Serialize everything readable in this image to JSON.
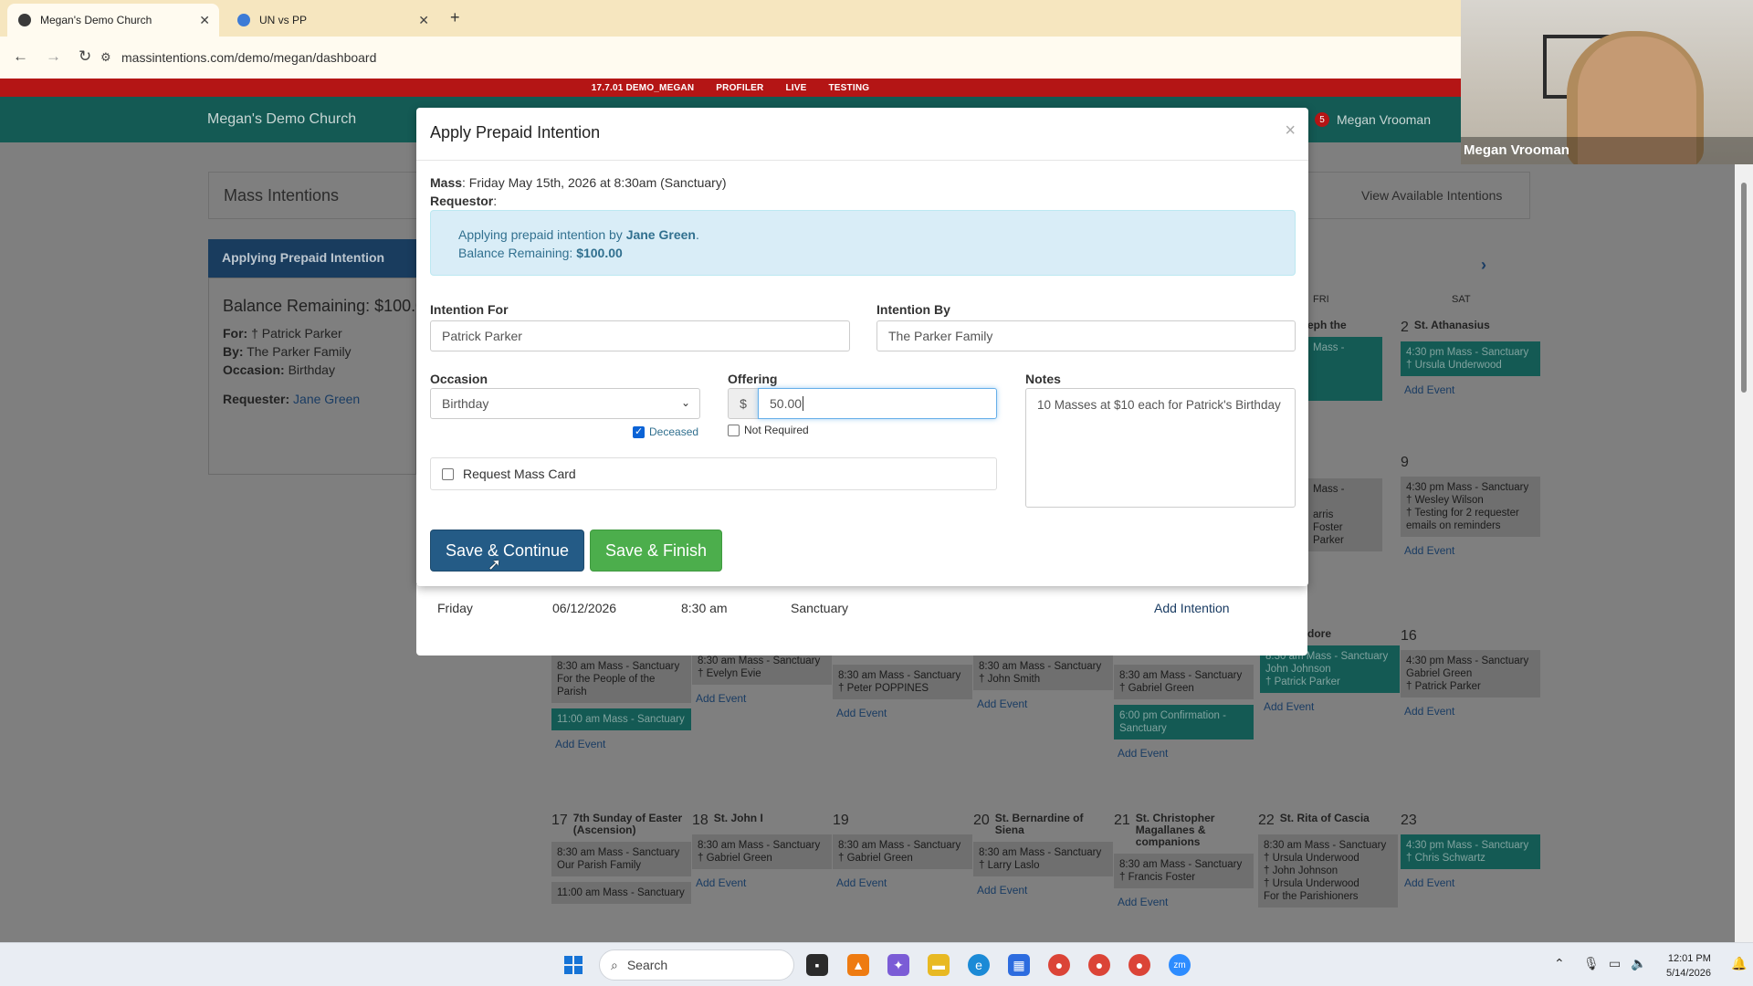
{
  "browser": {
    "tabs": [
      {
        "label": "Megan's Demo Church",
        "active": true
      },
      {
        "label": "UN vs PP",
        "active": false
      }
    ],
    "url": "massintentions.com/demo/megan/dashboard"
  },
  "envbar": [
    "17.7.01 DEMO_MEGAN",
    "PROFILER",
    "LIVE",
    "TESTING"
  ],
  "navbar": {
    "brand": "Megan's Demo Church",
    "badge": "5",
    "user": "Megan Vrooman"
  },
  "background": {
    "panel_title": "Mass Intentions",
    "view_available": "View Available Intentions",
    "left_card": {
      "header": "Applying Prepaid Intention",
      "balance": "Balance Remaining: $100.00",
      "for_label": "For:",
      "for_value": "† Patrick Parker",
      "by_label": "By:",
      "by_value": "The Parker Family",
      "occasion_label": "Occasion:",
      "occasion_value": "Birthday",
      "requester_label": "Requester:",
      "requester_value": "Jane Green"
    },
    "under_row": {
      "day": "Friday",
      "date": "06/12/2026",
      "time": "8:30 am",
      "location": "Sanctuary",
      "action": "Add Intention"
    },
    "calendar": {
      "dow": [
        "FRI",
        "SAT"
      ],
      "add_event": "Add Event"
    }
  },
  "modal": {
    "title": "Apply Prepaid Intention",
    "mass_label": "Mass",
    "mass_value": ": Friday May 15th, 2026 at 8:30am (Sanctuary)",
    "requestor_label": "Requestor",
    "info_prefix": "Applying prepaid intention by ",
    "info_name": "Jane Green",
    "info_balance_label": "Balance Remaining: ",
    "info_balance_value": "$100.00",
    "intention_for_label": "Intention For",
    "intention_for_value": "Patrick Parker",
    "intention_by_label": "Intention By",
    "intention_by_value": "The Parker Family",
    "occasion_label": "Occasion",
    "occasion_value": "Birthday",
    "deceased_label": "Deceased",
    "deceased_checked": true,
    "offering_label": "Offering",
    "offering_currency": "$",
    "offering_value": "50.00",
    "not_required_label": "Not Required",
    "notes_label": "Notes",
    "notes_value": "10 Masses at $10 each for Patrick's Birthday",
    "mass_card_label": "Request Mass Card",
    "save_continue": "Save & Continue",
    "save_finish": "Save & Finish"
  },
  "webcam": {
    "name": "Megan Vrooman"
  },
  "taskbar": {
    "search": "Search",
    "time": "12:01 PM",
    "date": "5/14/2026"
  },
  "colors": {
    "navbar": "#145a54",
    "envbar": "#b41515",
    "primary": "#245b86",
    "success": "#4cae4c",
    "info_bg": "#d9edf7"
  }
}
